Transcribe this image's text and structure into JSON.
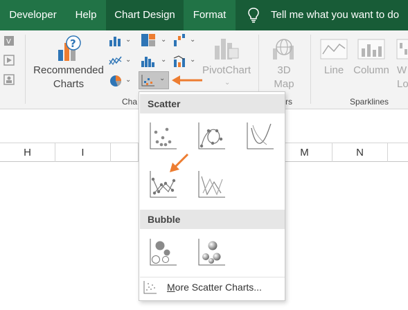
{
  "tabs": [
    {
      "label": "Developer",
      "active": false
    },
    {
      "label": "Help",
      "active": false
    },
    {
      "label": "Chart Design",
      "active": true
    },
    {
      "label": "Format",
      "active": false
    }
  ],
  "tell_me": {
    "text": "Tell me what you want to do",
    "icon": "lightbulb-icon"
  },
  "ribbon": {
    "recommended_charts": {
      "line1": "Recommended",
      "line2": "Charts"
    },
    "pivotchart": "PivotChart",
    "map": {
      "line1": "3D",
      "line2": "Map"
    },
    "sparklines": {
      "line": "Line",
      "column": "Column",
      "winloss_partial_1": "W",
      "winloss_partial_2": "Lo"
    },
    "groups": {
      "charts_partial": "Cha",
      "tours_partial": "rs",
      "sparklines": "Sparklines"
    }
  },
  "columns": [
    "H",
    "I",
    "M",
    "N"
  ],
  "menu": {
    "scatter_header": "Scatter",
    "bubble_header": "Bubble",
    "more_prefix": "M",
    "more_rest": "ore Scatter Charts...",
    "scatter_items": [
      "scatter",
      "scatter-smooth-lines-markers",
      "scatter-smooth-lines",
      "scatter-straight-lines-markers",
      "scatter-straight-lines"
    ],
    "bubble_items": [
      "bubble",
      "3d-bubble"
    ]
  },
  "colors": {
    "tab_bar": "#217346",
    "tab_active": "#185c37",
    "ribbon_bg": "#f3f3f3",
    "accent_arrow": "#ed7d31",
    "selected_button": "#c5c5c5"
  }
}
